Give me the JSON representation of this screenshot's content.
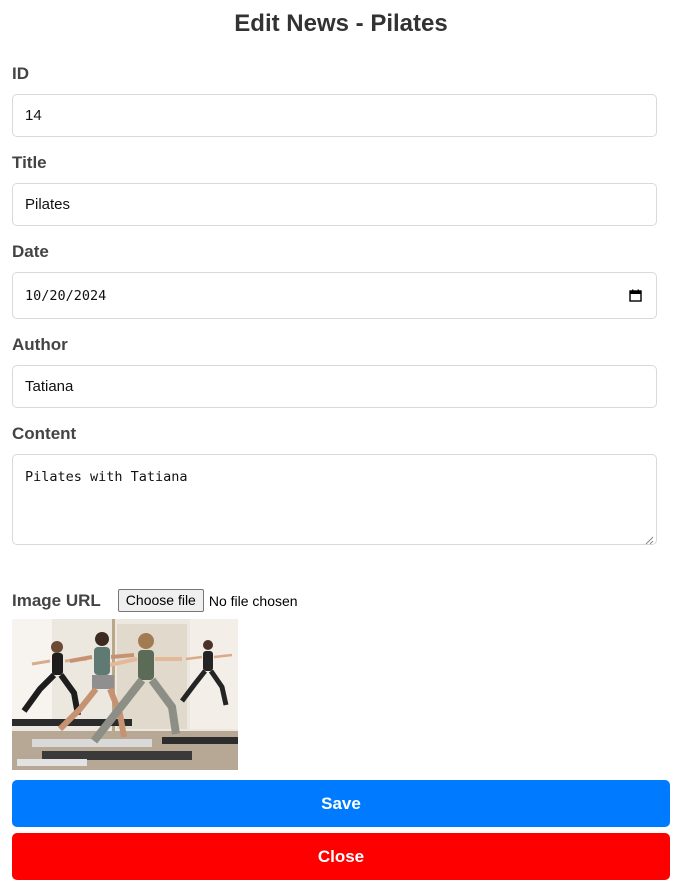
{
  "page": {
    "title": "Edit News - Pilates"
  },
  "form": {
    "id_label": "ID",
    "id_value": "14",
    "title_label": "Title",
    "title_value": "Pilates",
    "date_label": "Date",
    "date_value": "10/20/2024",
    "author_label": "Author",
    "author_value": "Tatiana",
    "content_label": "Content",
    "content_value": "Pilates with Tatiana",
    "image_label": "Image URL",
    "choose_file_label": "Choose file",
    "no_file_text": "No file chosen"
  },
  "image": {
    "subject": "pilates-class-on-reformer-machines"
  },
  "buttons": {
    "save_label": "Save",
    "close_label": "Close"
  },
  "colors": {
    "save": "#007bff",
    "close": "#ff0000",
    "title_text": "#333333",
    "field_border": "#d9d9d9"
  },
  "icons": {
    "date": "calendar-icon",
    "textarea": "resize-grip-icon"
  }
}
